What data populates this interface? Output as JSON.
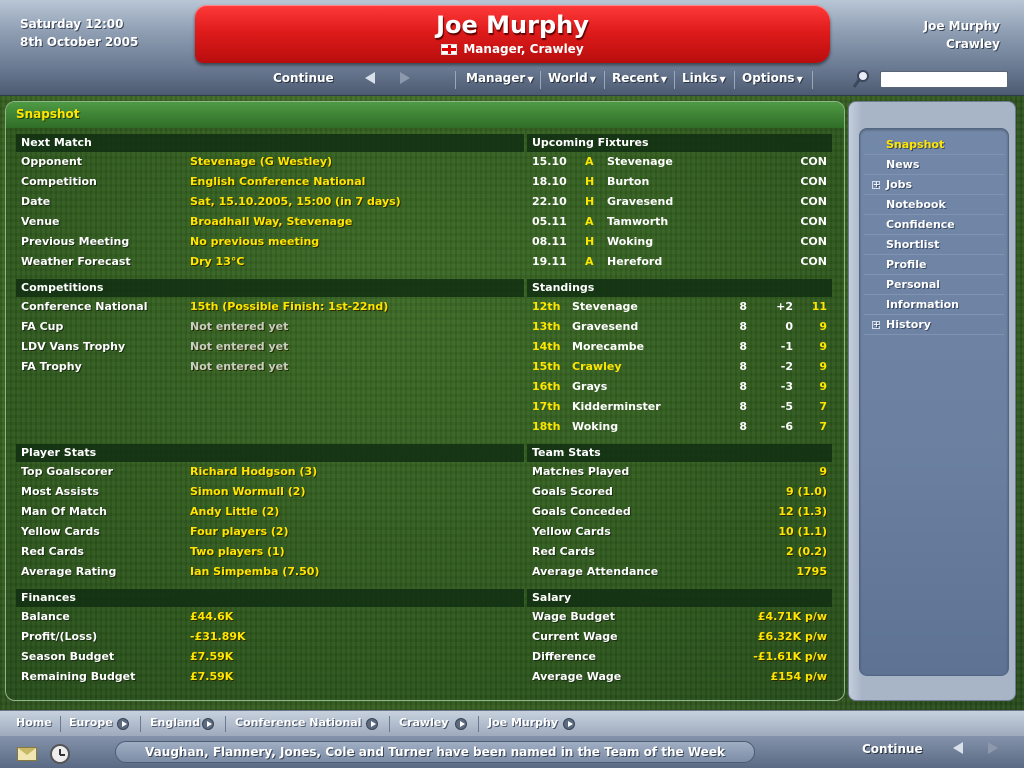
{
  "header": {
    "date_line1": "Saturday 12:00",
    "date_line2": "8th October 2005",
    "manager_name": "Joe Murphy",
    "manager_role": "Manager, Crawley",
    "user_name": "Joe Murphy",
    "user_club": "Crawley"
  },
  "toolbar": {
    "continue": "Continue",
    "menus": [
      "Manager",
      "World",
      "Recent",
      "Links",
      "Options"
    ]
  },
  "panel": {
    "title": "Snapshot"
  },
  "next_match": {
    "header": "Next Match",
    "rows": [
      {
        "label": "Opponent",
        "value": "Stevenage (G Westley)"
      },
      {
        "label": "Competition",
        "value": "English Conference National"
      },
      {
        "label": "Date",
        "value": "Sat, 15.10.2005, 15:00 (in 7 days)"
      },
      {
        "label": "Venue",
        "value": "Broadhall Way, Stevenage"
      },
      {
        "label": "Previous Meeting",
        "value": "No previous meeting"
      },
      {
        "label": "Weather Forecast",
        "value": "Dry 13°C"
      }
    ]
  },
  "fixtures": {
    "header": "Upcoming Fixtures",
    "rows": [
      {
        "date": "15.10",
        "ha": "A",
        "team": "Stevenage",
        "comp": "CON"
      },
      {
        "date": "18.10",
        "ha": "H",
        "team": "Burton",
        "comp": "CON"
      },
      {
        "date": "22.10",
        "ha": "H",
        "team": "Gravesend",
        "comp": "CON"
      },
      {
        "date": "05.11",
        "ha": "A",
        "team": "Tamworth",
        "comp": "CON"
      },
      {
        "date": "08.11",
        "ha": "H",
        "team": "Woking",
        "comp": "CON"
      },
      {
        "date": "19.11",
        "ha": "A",
        "team": "Hereford",
        "comp": "CON"
      }
    ]
  },
  "competitions": {
    "header": "Competitions",
    "rows": [
      {
        "label": "Conference National",
        "value": "15th (Possible Finish: 1st-22nd)"
      },
      {
        "label": "FA Cup",
        "value": "Not entered yet"
      },
      {
        "label": "LDV Vans Trophy",
        "value": "Not entered yet"
      },
      {
        "label": "FA Trophy",
        "value": "Not entered yet"
      }
    ]
  },
  "standings": {
    "header": "Standings",
    "rows": [
      {
        "pos": "12th",
        "team": "Stevenage",
        "pl": "8",
        "gd": "+2",
        "pts": "11"
      },
      {
        "pos": "13th",
        "team": "Gravesend",
        "pl": "8",
        "gd": "0",
        "pts": "9"
      },
      {
        "pos": "14th",
        "team": "Morecambe",
        "pl": "8",
        "gd": "-1",
        "pts": "9"
      },
      {
        "pos": "15th",
        "team": "Crawley",
        "pl": "8",
        "gd": "-2",
        "pts": "9"
      },
      {
        "pos": "16th",
        "team": "Grays",
        "pl": "8",
        "gd": "-3",
        "pts": "9"
      },
      {
        "pos": "17th",
        "team": "Kidderminster",
        "pl": "8",
        "gd": "-5",
        "pts": "7"
      },
      {
        "pos": "18th",
        "team": "Woking",
        "pl": "8",
        "gd": "-6",
        "pts": "7"
      }
    ]
  },
  "player_stats": {
    "header": "Player Stats",
    "rows": [
      {
        "label": "Top Goalscorer",
        "value": "Richard Hodgson (3)"
      },
      {
        "label": "Most Assists",
        "value": "Simon Wormull (2)"
      },
      {
        "label": "Man Of Match",
        "value": "Andy Little (2)"
      },
      {
        "label": "Yellow Cards",
        "value": "Four players (2)"
      },
      {
        "label": "Red Cards",
        "value": "Two players (1)"
      },
      {
        "label": "Average Rating",
        "value": "Ian Simpemba (7.50)"
      }
    ]
  },
  "team_stats": {
    "header": "Team Stats",
    "rows": [
      {
        "label": "Matches Played",
        "value": "9"
      },
      {
        "label": "Goals Scored",
        "value": "9 (1.0)"
      },
      {
        "label": "Goals Conceded",
        "value": "12 (1.3)"
      },
      {
        "label": "Yellow Cards",
        "value": "10 (1.1)"
      },
      {
        "label": "Red Cards",
        "value": "2 (0.2)"
      },
      {
        "label": "Average Attendance",
        "value": "1795"
      }
    ]
  },
  "finances": {
    "header": "Finances",
    "rows": [
      {
        "label": "Balance",
        "value": "£44.6K"
      },
      {
        "label": "Profit/(Loss)",
        "value": "-£31.89K"
      },
      {
        "label": "Season Budget",
        "value": "£7.59K"
      },
      {
        "label": "Remaining Budget",
        "value": "£7.59K"
      }
    ]
  },
  "salary": {
    "header": "Salary",
    "rows": [
      {
        "label": "Wage Budget",
        "value": "£4.71K p/w"
      },
      {
        "label": "Current Wage",
        "value": "£6.32K p/w"
      },
      {
        "label": "Difference",
        "value": "-£1.61K p/w"
      },
      {
        "label": "Average Wage",
        "value": "£154 p/w"
      }
    ]
  },
  "sidebar": {
    "items": [
      {
        "label": "Snapshot"
      },
      {
        "label": "News"
      },
      {
        "label": "Jobs"
      },
      {
        "label": "Notebook"
      },
      {
        "label": "Confidence"
      },
      {
        "label": "Shortlist"
      },
      {
        "label": "Profile"
      },
      {
        "label": "Personal"
      },
      {
        "label": "Information"
      },
      {
        "label": "History"
      }
    ]
  },
  "breadcrumb": [
    "Home",
    "Europe",
    "England",
    "Conference National",
    "Crawley",
    "Joe Murphy"
  ],
  "status": {
    "news": "Vaughan, Flannery, Jones, Cole and Turner have been named in the Team of the Week",
    "continue": "Continue"
  }
}
